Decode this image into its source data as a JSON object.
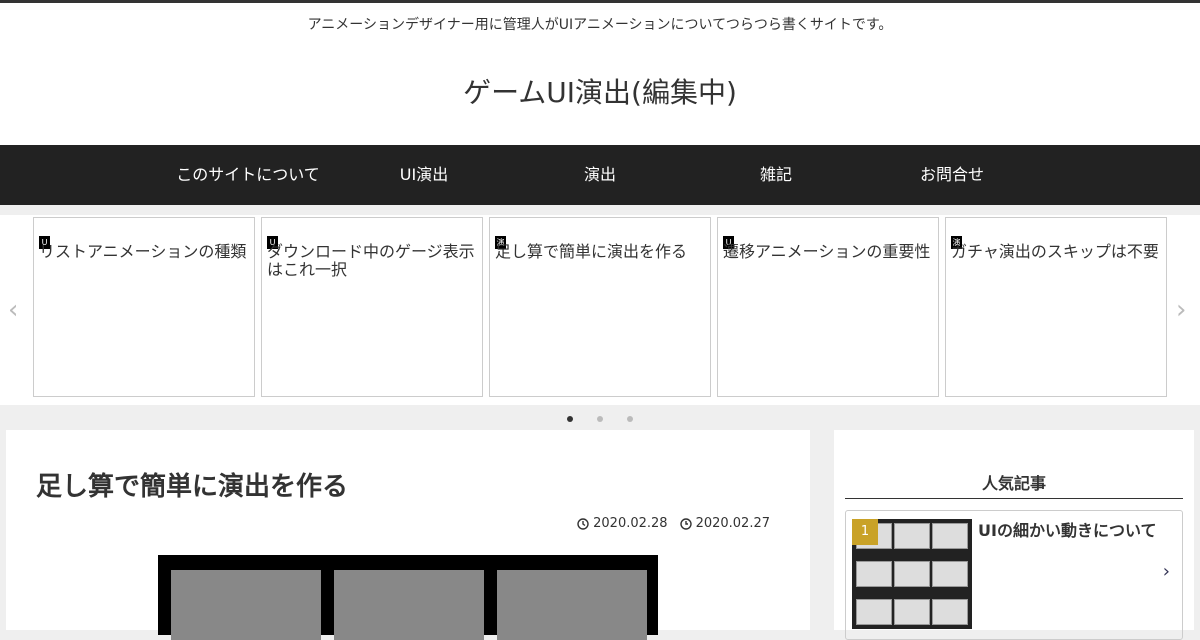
{
  "header": {
    "tagline": "アニメーションデザイナー用に管理人がUIアニメーションについてつらつら書くサイトです。",
    "site_title": "ゲームUI演出(編集中)"
  },
  "nav": {
    "items": [
      {
        "label": "このサイトについて"
      },
      {
        "label": "UI演出"
      },
      {
        "label": "演出"
      },
      {
        "label": "雑記"
      },
      {
        "label": "お問合せ"
      }
    ]
  },
  "carousel": {
    "cards": [
      {
        "badge": "U",
        "title": "リストアニメーションの種類"
      },
      {
        "badge": "U",
        "title": "ダウンロード中のゲージ表示はこれ一択"
      },
      {
        "badge": "演",
        "title": "足し算で簡単に演出を作る"
      },
      {
        "badge": "U",
        "title": "遷移アニメーションの重要性"
      },
      {
        "badge": "演",
        "title": "ガチャ演出のスキップは不要"
      }
    ],
    "prev_icon": "chevron-left-icon",
    "next_icon": "chevron-right-icon",
    "dots_total": 3,
    "dots_active": 1
  },
  "article": {
    "title": "足し算で簡単に演出を作る",
    "updated": "2020.02.28",
    "published": "2020.02.27"
  },
  "sidebar": {
    "title": "人気記事",
    "popular": [
      {
        "rank": "1",
        "title": "UIの細かい動きについて"
      }
    ]
  },
  "colors": {
    "nav_bg": "#222222",
    "rank_badge": "#c9a227",
    "page_bg": "#efefef"
  }
}
